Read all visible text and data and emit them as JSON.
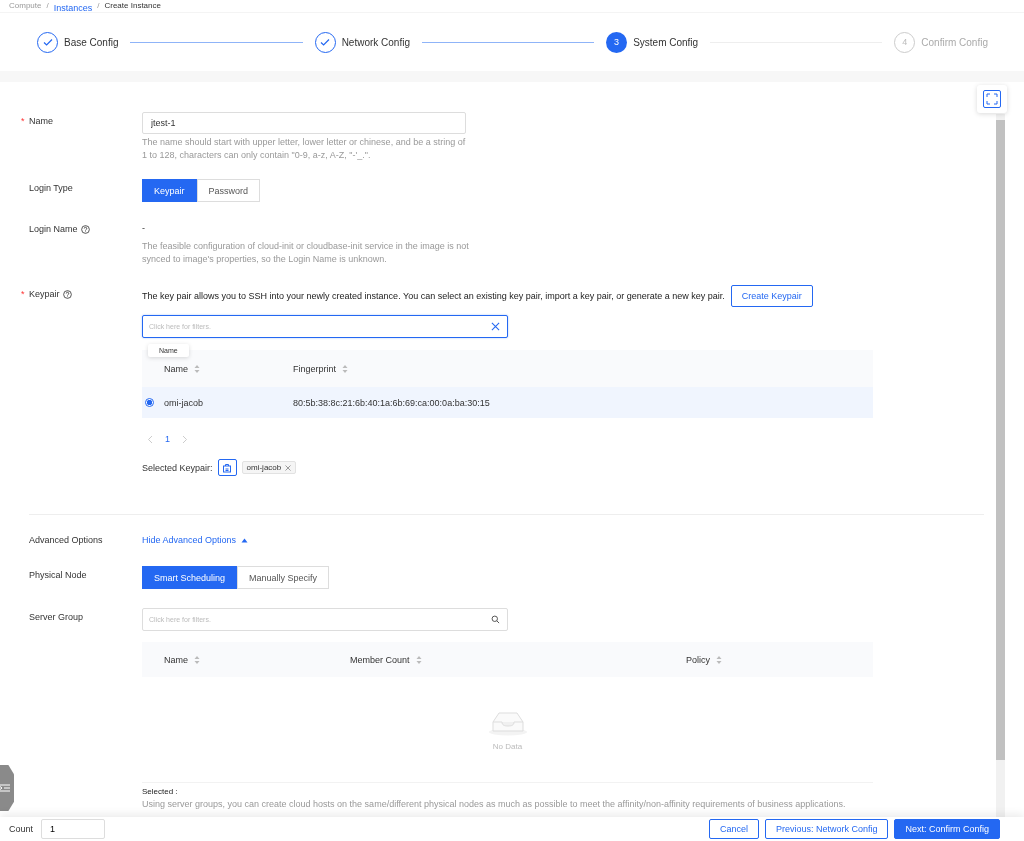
{
  "breadcrumb": [
    {
      "label": "Compute",
      "kind": "plain"
    },
    {
      "label": "/",
      "kind": "separator"
    },
    {
      "label": "Instances",
      "kind": "link"
    },
    {
      "label": "/",
      "kind": "separator"
    },
    {
      "label": "Create Instance",
      "kind": "current"
    }
  ],
  "steps": [
    {
      "label": "Base Config",
      "completed": true,
      "selected": false
    },
    {
      "label": "Network Config",
      "completed": true,
      "selected": false
    },
    {
      "label": "System Config",
      "completed": false,
      "selected": true,
      "number": "3"
    },
    {
      "label": "Confirm Config",
      "completed": false,
      "selected": false,
      "number": "4"
    }
  ],
  "name_field": {
    "label": "Name",
    "required_mark": "*",
    "value": "jtest-1",
    "hint": "The name should start with upper letter, lower letter or chinese, and be a string of 1 to 128, characters can only contain \"0-9, a-z, A-Z, \"-'_.\"."
  },
  "login_type": {
    "label": "Login Type",
    "options": [
      {
        "label": "Keypair",
        "selected": true
      },
      {
        "label": "Password",
        "selected": false
      }
    ]
  },
  "login_name": {
    "label": "Login Name",
    "value": "-",
    "hint": "The feasible configuration of cloud-init or cloudbase-init service in the image is not synced to image's properties, so the Login Name is unknown."
  },
  "keypair": {
    "label": "Keypair",
    "required_mark": "*",
    "description": "The key pair allows you to SSH into your newly created instance. You can select an existing key pair, import a key pair, or generate a new key pair.",
    "create_button": "Create Keypair",
    "filter": {
      "placeholder": "Click here for filters."
    },
    "tooltip": "Name",
    "table": {
      "columns": [
        "Name",
        "Fingerprint"
      ],
      "rows": [
        {
          "selected": true,
          "cells": [
            "omi-jacob",
            "80:5b:38:8c:21:6b:40:1a:6b:69:ca:00:0a:ba:30:15"
          ]
        }
      ]
    },
    "pages": [
      {
        "label": "1",
        "selected": true
      }
    ],
    "selected_label": "Selected Keypair:",
    "selected_tags": [
      "omi-jacob"
    ]
  },
  "advanced": {
    "label": "Advanced Options",
    "toggle": "Hide Advanced Options",
    "expanded": true
  },
  "physical_node": {
    "label": "Physical Node",
    "options": [
      {
        "label": "Smart Scheduling",
        "selected": true
      },
      {
        "label": "Manually Specify",
        "selected": false
      }
    ]
  },
  "server_group": {
    "label": "Server Group",
    "filter": {
      "placeholder": "Click here for filters."
    },
    "table": {
      "columns": [
        "Name",
        "Member Count",
        "Policy"
      ],
      "empty_text": "No Data"
    },
    "selected_label": "Selected :",
    "hint": "Using server groups, you can create cloud hosts on the same/different physical nodes as much as possible to meet the affinity/non-affinity requirements of business applications."
  },
  "footer": {
    "count_label": "Count",
    "count_value": "1",
    "buttons": [
      {
        "label": "Cancel",
        "kind": "default"
      },
      {
        "label": "Previous: Network Config",
        "kind": "default"
      },
      {
        "label": "Next: Confirm Config",
        "kind": "primary"
      }
    ]
  }
}
